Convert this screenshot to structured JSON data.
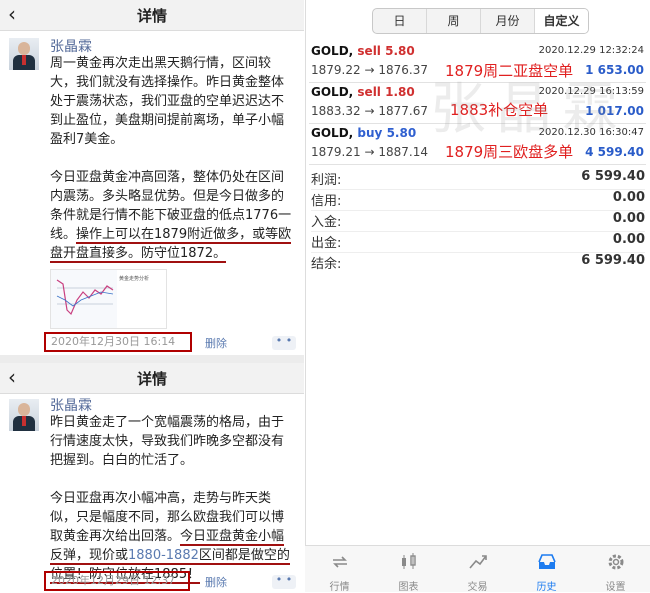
{
  "left_top": {
    "nav_title": "详情",
    "author": "张晶霖",
    "paragraph1": "周一黄金再次走出黑天鹅行情，区间较大，我们就没有选择操作。昨日黄金整体处于震荡状态，我们亚盘的空单迟迟达不到止盈位，美盘期间提前离场，单子小幅盈利7美金。",
    "paragraph2_plain": "今日亚盘黄金冲高回落，整体仍处在区间内震荡。多头略显优势。但是今日做多的条件就是行情不能下破亚盘的低点1776一线。",
    "paragraph2_underlined": "操作上可以在1879附近做多，或等欧盘开盘直接多。防守位1872。",
    "thumb_caption": "黄金走势分析",
    "timestamp": "2020年12月30日 16:14",
    "delete_label": "删除",
    "more_label": "• •"
  },
  "left_bottom": {
    "nav_title": "详情",
    "author": "张晶霖",
    "paragraph1": "昨日黄金走了一个宽幅震荡的格局，由于行情速度太快，导致我们昨晚多空都没有把握到。白白的忙活了。",
    "paragraph2_plain": "今日亚盘再次小幅冲高，走势与昨天类似，只是幅度不同，那么欧盘我们可以博取黄金再次给出回落。",
    "paragraph2_underlined_a": "今日亚盘黄金小幅反弹，现价或",
    "paragraph2_range": "1880-1882",
    "paragraph2_underlined_b": "区间都是做空的位置！防守位放在1885！",
    "timestamp": "2020年12月29日 12:37",
    "delete_label": "删除",
    "more_label": "• •"
  },
  "segments": [
    "日",
    "周",
    "月份",
    "自定义"
  ],
  "active_segment": "自定义",
  "orders": [
    {
      "symbol": "GOLD,",
      "side": "sell",
      "lots": "5.80",
      "date": "2020.12.29 12:32:24",
      "open": "1879.22",
      "close": "1876.37",
      "profit": "1 653.00",
      "note": "1879周二亚盘空单"
    },
    {
      "symbol": "GOLD,",
      "side": "sell",
      "lots": "1.80",
      "date": "2020.12.29 16:13:59",
      "open": "1883.32",
      "close": "1877.67",
      "profit": "1 017.00",
      "note": "1883补仓空单"
    },
    {
      "symbol": "GOLD,",
      "side": "buy",
      "lots": "5.80",
      "date": "2020.12.30 16:30:47",
      "open": "1879.21",
      "close": "1887.14",
      "profit": "4 599.40",
      "note": "1879周三欧盘多单"
    }
  ],
  "arrow": "→",
  "summary": [
    {
      "label": "利润:",
      "value": "6 599.40"
    },
    {
      "label": "信用:",
      "value": "0.00"
    },
    {
      "label": "入金:",
      "value": "0.00"
    },
    {
      "label": "出金:",
      "value": "0.00"
    },
    {
      "label": "结余:",
      "value": "6 599.40"
    }
  ],
  "watermark": "张晶霖 策划",
  "tabs": [
    {
      "label": "行情",
      "icon": "quotes-icon"
    },
    {
      "label": "图表",
      "icon": "chart-icon"
    },
    {
      "label": "交易",
      "icon": "trade-icon"
    },
    {
      "label": "历史",
      "icon": "history-icon"
    },
    {
      "label": "设置",
      "icon": "settings-icon"
    }
  ],
  "active_tab": "历史",
  "colors": {
    "accent": "#1d7cf0",
    "sell": "#d03030",
    "buy": "#3060d0",
    "annotation": "#e02020",
    "highlight_box": "#b00000"
  }
}
